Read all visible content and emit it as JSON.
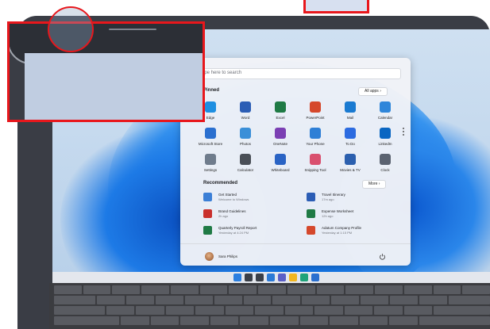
{
  "start_menu": {
    "search_placeholder": "Type here to search",
    "pinned_title": "Pinned",
    "all_apps_label": "All apps",
    "pinned_apps": [
      {
        "label": "Edge",
        "color": "#1e8fe1",
        "icon": "edge-icon"
      },
      {
        "label": "Word",
        "color": "#2b5db5",
        "icon": "word-icon"
      },
      {
        "label": "Excel",
        "color": "#1f7a45",
        "icon": "excel-icon"
      },
      {
        "label": "PowerPoint",
        "color": "#d5482c",
        "icon": "powerpoint-icon"
      },
      {
        "label": "Mail",
        "color": "#1a7ad1",
        "icon": "mail-icon"
      },
      {
        "label": "Calendar",
        "color": "#2f86da",
        "icon": "calendar-icon"
      },
      {
        "label": "Microsoft Store",
        "color": "#2a6fcf",
        "icon": "store-icon"
      },
      {
        "label": "Photos",
        "color": "#3a8fd8",
        "icon": "photos-icon"
      },
      {
        "label": "OneNote",
        "color": "#7b3fb3",
        "icon": "onenote-icon"
      },
      {
        "label": "Your Phone",
        "color": "#2e7fd6",
        "icon": "phone-icon"
      },
      {
        "label": "To Do",
        "color": "#2c6be0",
        "icon": "todo-icon"
      },
      {
        "label": "LinkedIn",
        "color": "#0a66c2",
        "icon": "linkedin-icon"
      },
      {
        "label": "Settings",
        "color": "#6f7c8c",
        "icon": "settings-icon"
      },
      {
        "label": "Calculator",
        "color": "#4a4f57",
        "icon": "calculator-icon"
      },
      {
        "label": "Whiteboard",
        "color": "#2a63c4",
        "icon": "whiteboard-icon"
      },
      {
        "label": "Snipping Tool",
        "color": "#d9506f",
        "icon": "snipping-icon"
      },
      {
        "label": "Movies & TV",
        "color": "#2b5fae",
        "icon": "movies-icon"
      },
      {
        "label": "Clock",
        "color": "#5a6270",
        "icon": "clock-icon"
      }
    ],
    "recommended_title": "Recommended",
    "more_label": "More",
    "recommended": [
      {
        "title": "Get Started",
        "sub": "Welcome to Windows",
        "color": "#3b7fd6",
        "icon": "get-started-icon"
      },
      {
        "title": "Travel Itinerary",
        "sub": "17m ago",
        "color": "#2b5db5",
        "icon": "word-doc-icon"
      },
      {
        "title": "Brand Guidelines",
        "sub": "2h ago",
        "color": "#c9302c",
        "icon": "pdf-icon"
      },
      {
        "title": "Expense Worksheet",
        "sub": "12h ago",
        "color": "#1f7a45",
        "icon": "excel-doc-icon"
      },
      {
        "title": "Quarterly Payroll Report",
        "sub": "Yesterday at 4:24 PM",
        "color": "#1f7a45",
        "icon": "excel-doc-icon"
      },
      {
        "title": "Adatum Company Profile",
        "sub": "Yesterday at 1:15 PM",
        "color": "#d5482c",
        "icon": "ppt-doc-icon"
      }
    ],
    "user_name": "Sara Philips"
  },
  "taskbar": {
    "icons": [
      {
        "name": "start-icon",
        "color": "#2b7fe0"
      },
      {
        "name": "search-icon",
        "color": "#3a3f48"
      },
      {
        "name": "task-view-icon",
        "color": "#3a3f48"
      },
      {
        "name": "widgets-icon",
        "color": "#2c7ad6"
      },
      {
        "name": "chat-icon",
        "color": "#5b5fc7"
      },
      {
        "name": "file-explorer-icon",
        "color": "#f2b61f"
      },
      {
        "name": "edge-icon",
        "color": "#1fa37a"
      },
      {
        "name": "store-icon",
        "color": "#2a6fcf"
      }
    ]
  }
}
